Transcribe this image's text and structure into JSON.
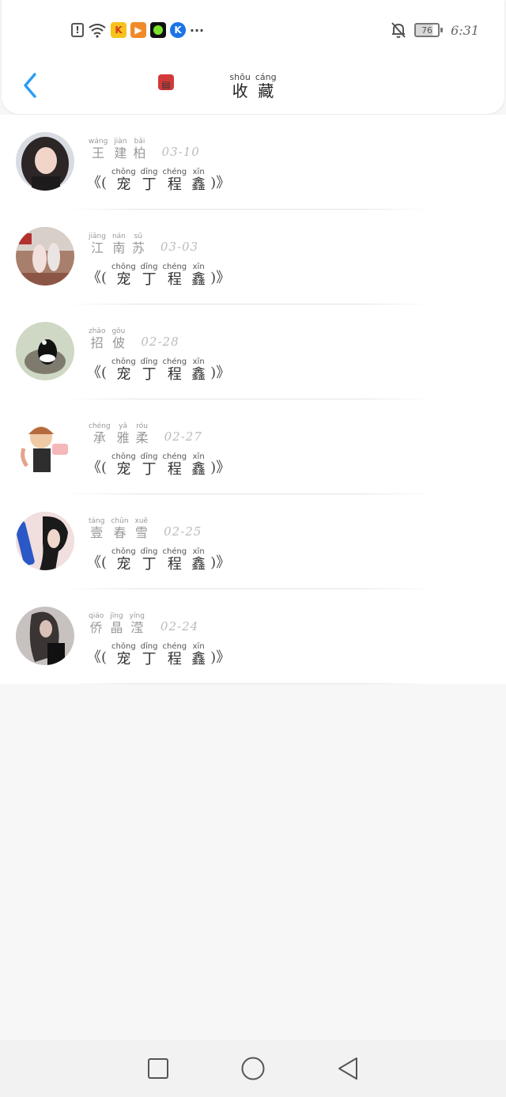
{
  "status_bar": {
    "time": "6:31",
    "battery": "76",
    "more_indicator": "···"
  },
  "header": {
    "title": [
      {
        "py": "shōu",
        "hz": "收"
      },
      {
        "py": "cáng",
        "hz": "藏"
      }
    ]
  },
  "favorites": [
    {
      "name": [
        {
          "py": "wáng",
          "hz": "王"
        },
        {
          "py": "jiàn",
          "hz": "建"
        },
        {
          "py": "bǎi",
          "hz": "柏"
        }
      ],
      "date": "03-10",
      "book_open": "《(",
      "book_close": ")》",
      "book": [
        {
          "py": "chōng",
          "hz": "宠"
        },
        {
          "py": "dīng",
          "hz": "丁"
        },
        {
          "py": "chéng",
          "hz": "程"
        },
        {
          "py": "xīn",
          "hz": "鑫"
        }
      ]
    },
    {
      "name": [
        {
          "py": "jiāng",
          "hz": "江"
        },
        {
          "py": "nán",
          "hz": "南"
        },
        {
          "py": "sū",
          "hz": "苏"
        }
      ],
      "date": "03-03",
      "book_open": "《(",
      "book_close": ")》",
      "book": [
        {
          "py": "chōng",
          "hz": "宠"
        },
        {
          "py": "dīng",
          "hz": "丁"
        },
        {
          "py": "chéng",
          "hz": "程"
        },
        {
          "py": "xīn",
          "hz": "鑫"
        }
      ]
    },
    {
      "name": [
        {
          "py": "zhāo",
          "hz": "招"
        },
        {
          "py": "gǒu",
          "hz": "佊"
        }
      ],
      "date": "02-28",
      "book_open": "《(",
      "book_close": ")》",
      "book": [
        {
          "py": "chōng",
          "hz": "宠"
        },
        {
          "py": "dīng",
          "hz": "丁"
        },
        {
          "py": "chéng",
          "hz": "程"
        },
        {
          "py": "xīn",
          "hz": "鑫"
        }
      ]
    },
    {
      "name": [
        {
          "py": "chéng",
          "hz": "承"
        },
        {
          "py": "yǎ",
          "hz": "雅"
        },
        {
          "py": "róu",
          "hz": "柔"
        }
      ],
      "date": "02-27",
      "book_open": "《(",
      "book_close": ")》",
      "book": [
        {
          "py": "chōng",
          "hz": "宠"
        },
        {
          "py": "dīng",
          "hz": "丁"
        },
        {
          "py": "chéng",
          "hz": "程"
        },
        {
          "py": "xīn",
          "hz": "鑫"
        }
      ]
    },
    {
      "name": [
        {
          "py": "táng",
          "hz": "壹"
        },
        {
          "py": "chūn",
          "hz": "春"
        },
        {
          "py": "xuě",
          "hz": "雪"
        }
      ],
      "date": "02-25",
      "book_open": "《(",
      "book_close": ")》",
      "book": [
        {
          "py": "chōng",
          "hz": "宠"
        },
        {
          "py": "dīng",
          "hz": "丁"
        },
        {
          "py": "chéng",
          "hz": "程"
        },
        {
          "py": "xīn",
          "hz": "鑫"
        }
      ]
    },
    {
      "name": [
        {
          "py": "qiáo",
          "hz": "侨"
        },
        {
          "py": "jīng",
          "hz": "晶"
        },
        {
          "py": "yíng",
          "hz": "滢"
        }
      ],
      "date": "02-24",
      "book_open": "《(",
      "book_close": ")》",
      "book": [
        {
          "py": "chōng",
          "hz": "宠"
        },
        {
          "py": "dīng",
          "hz": "丁"
        },
        {
          "py": "chéng",
          "hz": "程"
        },
        {
          "py": "xīn",
          "hz": "鑫"
        }
      ]
    }
  ],
  "colors": {
    "accent": "#2a9df4",
    "list_bg": "#ffffff",
    "page_bg": "#f8f7f8"
  },
  "icons": {
    "back": "chevron-left-icon",
    "nav_recent": "square-icon",
    "nav_home": "circle-icon",
    "nav_back": "triangle-back-icon"
  }
}
